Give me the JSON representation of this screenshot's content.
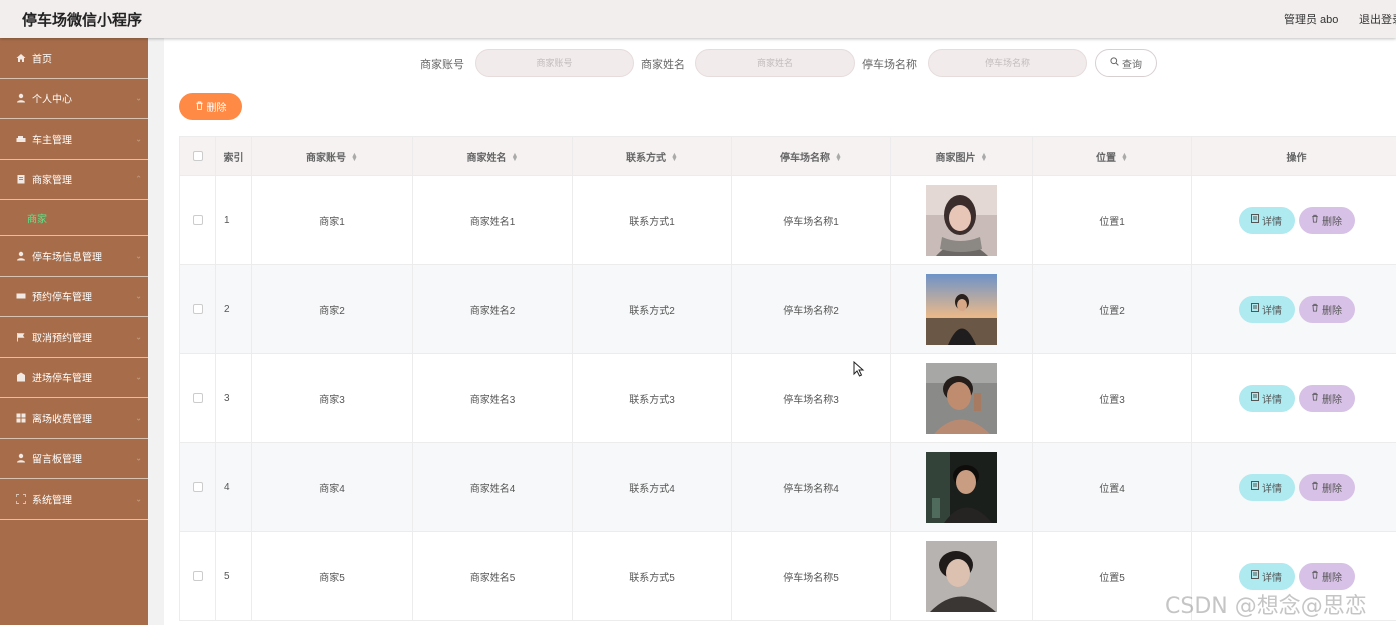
{
  "header": {
    "app_title": "停车场微信小程序",
    "admin_text": "管理员 abo",
    "logout_text": "退出登录"
  },
  "sidebar": {
    "items": [
      {
        "label": "首页",
        "icon": "home-icon"
      },
      {
        "label": "个人中心",
        "icon": "user-icon"
      },
      {
        "label": "车主管理",
        "icon": "car-icon"
      },
      {
        "label": "商家管理",
        "icon": "document-icon",
        "expanded": true
      },
      {
        "label": "商家",
        "sub": true,
        "active": true
      },
      {
        "label": "停车场信息管理",
        "icon": "user-icon"
      },
      {
        "label": "预约停车管理",
        "icon": "card-icon"
      },
      {
        "label": "取消预约管理",
        "icon": "flag-icon"
      },
      {
        "label": "进场停车管理",
        "icon": "building-icon"
      },
      {
        "label": "离场收费管理",
        "icon": "grid-icon"
      },
      {
        "label": "留言板管理",
        "icon": "user-icon"
      },
      {
        "label": "系统管理",
        "icon": "fullscreen-icon"
      }
    ]
  },
  "search": {
    "account_label": "商家账号",
    "account_placeholder": "商家账号",
    "name_label": "商家姓名",
    "name_placeholder": "商家姓名",
    "parking_label": "停车场名称",
    "parking_placeholder": "停车场名称",
    "query_button": "查询"
  },
  "toolbar": {
    "delete_button": "删除"
  },
  "table": {
    "headers": {
      "index": "索引",
      "account": "商家账号",
      "name": "商家姓名",
      "contact": "联系方式",
      "parking": "停车场名称",
      "image": "商家图片",
      "location": "位置",
      "actions": "操作"
    },
    "rows": [
      {
        "index": "1",
        "account": "商家1",
        "name": "商家姓名1",
        "contact": "联系方式1",
        "parking": "停车场名称1",
        "location": "位置1"
      },
      {
        "index": "2",
        "account": "商家2",
        "name": "商家姓名2",
        "contact": "联系方式2",
        "parking": "停车场名称2",
        "location": "位置2"
      },
      {
        "index": "3",
        "account": "商家3",
        "name": "商家姓名3",
        "contact": "联系方式3",
        "parking": "停车场名称3",
        "location": "位置3"
      },
      {
        "index": "4",
        "account": "商家4",
        "name": "商家姓名4",
        "contact": "联系方式4",
        "parking": "停车场名称4",
        "location": "位置4"
      },
      {
        "index": "5",
        "account": "商家5",
        "name": "商家姓名5",
        "contact": "联系方式5",
        "parking": "停车场名称5",
        "location": "位置5"
      }
    ],
    "detail_button": "详情",
    "delete_button": "删除"
  },
  "watermark": "CSDN @想念@思恋",
  "colors": {
    "sidebar_bg": "#a76d4a",
    "active_sub": "#5ce58b",
    "delete_top": "#ff8a45",
    "detail_btn": "#aeeaf0",
    "delete_btn": "#d7c1e6"
  }
}
